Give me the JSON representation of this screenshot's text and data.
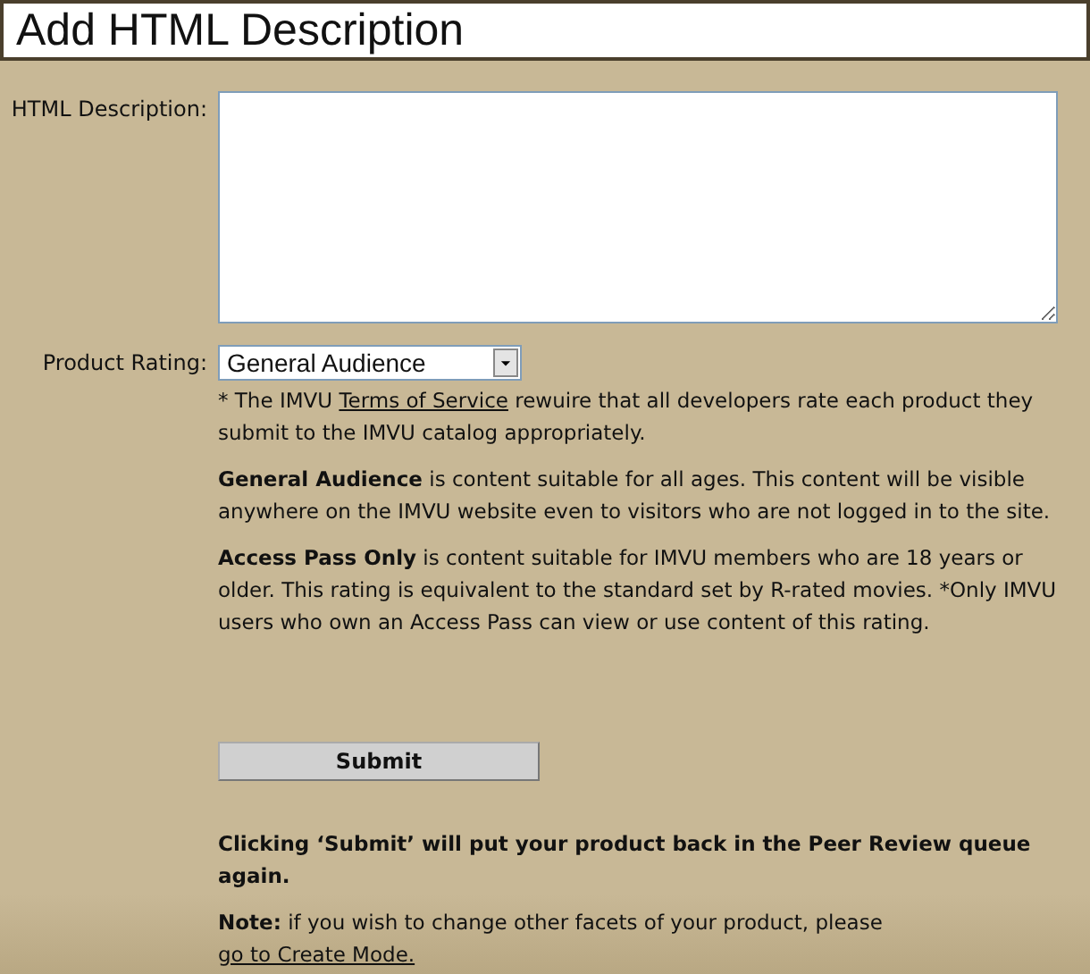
{
  "title": "Add HTML Description",
  "description_field": {
    "label": "HTML Description:"
  },
  "rating": {
    "label": "Product Rating:",
    "value": "General Audience"
  },
  "terms": {
    "before": "* The IMVU ",
    "link": "Terms of Service",
    "after": " rewuire that all  developers rate each product they submit to the IMVU catalog appropriately."
  },
  "ratings_info": [
    "**General Audience** is content suitable for all ages. This content will be visible anywhere on the IMVU website even to visitors who are not logged in to the site.",
    "**Access Pass Only** is content suitable for IMVU members who are 18 years or older. This rating is equivalent to the standard set by R-rated movies. *Only IMVU users who own an Access Pass can view or use content of this rating."
  ],
  "submit": "Submit",
  "warning": "Clicking ‘Submit’ will put your product back in the Peer Review queue again.",
  "note": {
    "before": "**Note:** if you wish to change other facets of your product, please ",
    "link": "go to Create Mode."
  }
}
